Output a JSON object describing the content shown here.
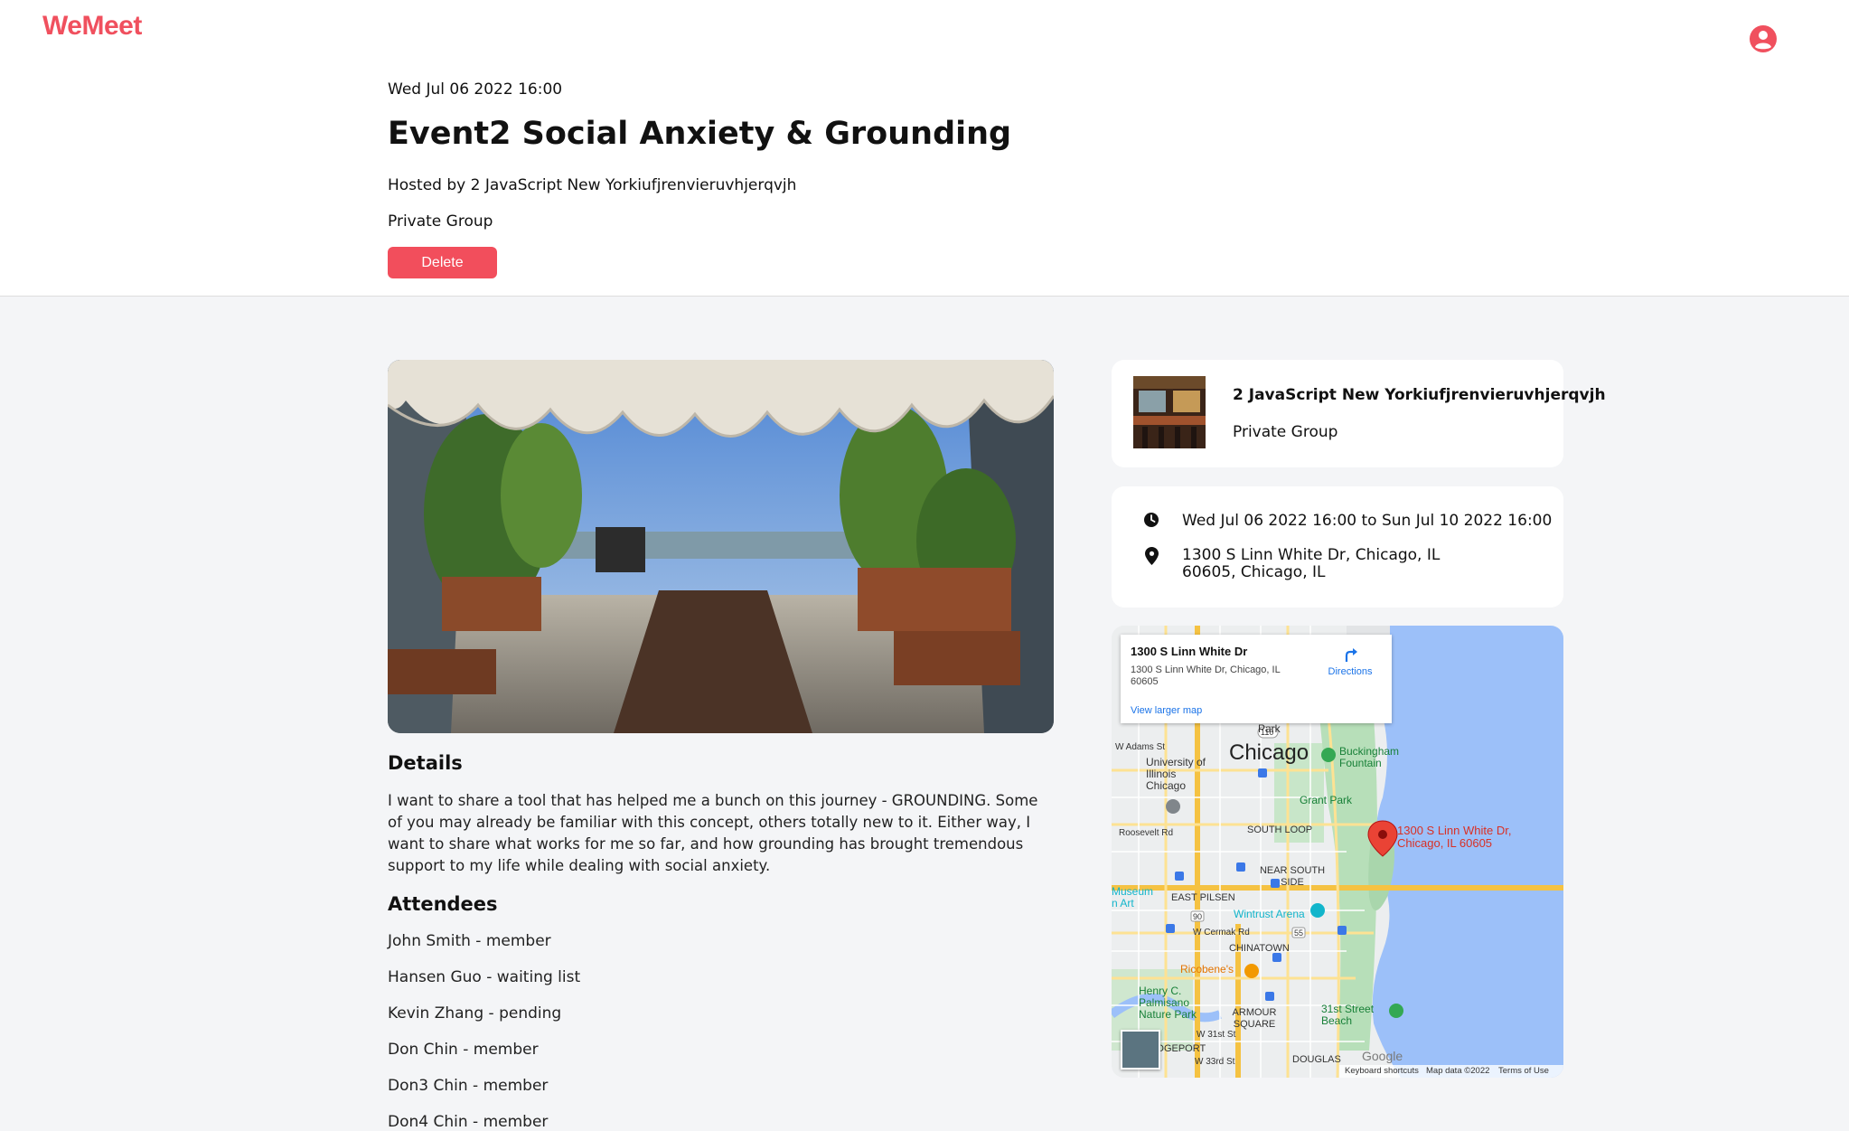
{
  "app": {
    "logo": "WeMeet"
  },
  "event": {
    "date": "Wed Jul 06 2022 16:00",
    "title": "Event2 Social Anxiety & Grounding",
    "hosted_by": "Hosted by 2 JavaScript New Yorkiufjrenvieruvhjerqvjh",
    "privacy": "Private Group",
    "delete_label": "Delete"
  },
  "details": {
    "heading": "Details",
    "text": "I want to share a tool that has helped me a bunch on this journey - GROUNDING. Some of you may already be familiar with this concept, others totally new to it. Either way, I want to share what works for me so far, and how grounding has brought tremendous support to my life while dealing with social anxiety."
  },
  "attendees": {
    "heading": "Attendees",
    "items": [
      "John Smith - member",
      "Hansen Guo - waiting list",
      "Kevin Zhang - pending",
      "Don Chin - member",
      "Don3 Chin - member",
      "Don4 Chin - member"
    ]
  },
  "group_card": {
    "name": "2 JavaScript New Yorkiufjrenvieruvhjerqvjh",
    "type": "Private Group"
  },
  "info_card": {
    "time": "Wed Jul 06 2022 16:00 to Sun Jul 10 2022 16:00",
    "location": "1300 S Linn White Dr, Chicago, IL 60605, Chicago, IL"
  },
  "map": {
    "popup_title": "1300 S Linn White Dr",
    "popup_address": "1300 S Linn White Dr, Chicago, IL 60605",
    "directions": "Directions",
    "view_larger": "View larger map",
    "city": "Chicago",
    "marker_label": "1300 S Linn White Dr, Chicago, IL 60605",
    "labels": {
      "park": "Park",
      "w_adams": "W Adams St",
      "uic": "University of Illinois Chicago",
      "buckingham": "Buckingham Fountain",
      "grant_park": "Grant Park",
      "roosevelt": "Roosevelt Rd",
      "south_loop": "SOUTH LOOP",
      "near_south": "NEAR SOUTH SIDE",
      "museum": "Museum n Art",
      "east_pilsen": "EAST PILSEN",
      "wintrust": "Wintrust Arena",
      "cermak": "W Cermak Rd",
      "chinatown": "CHINATOWN",
      "ricobenes": "Ricobene's",
      "palmisano": "Henry C. Palmisano Nature Park",
      "armour": "ARMOUR SQUARE",
      "beach31": "31st Street Beach",
      "w31": "W 31st St",
      "bridgeport": "DGEPORT",
      "w33": "W 33rd St",
      "douglas": "DOUGLAS",
      "route110": "110",
      "route55": "55",
      "route90": "90"
    },
    "footer": {
      "shortcuts": "Keyboard shortcuts",
      "mapdata": "Map data ©2022",
      "terms": "Terms of Use"
    },
    "google": "Google"
  },
  "colors": {
    "accent": "#f0505e",
    "delete": "#f24e5c",
    "link": "#1a73e8",
    "water": "#9cc0f9"
  }
}
